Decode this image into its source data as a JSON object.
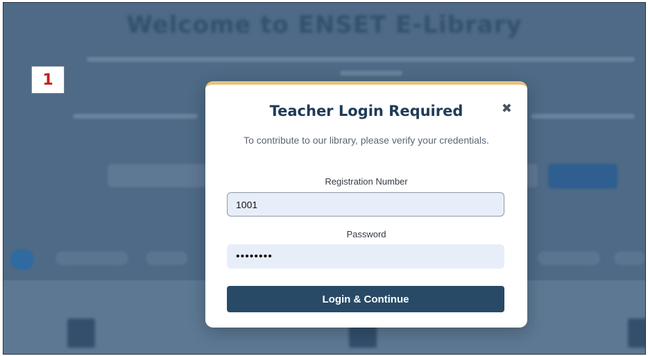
{
  "background": {
    "title": "Welcome to ENSET E-Library"
  },
  "step_badge": "1",
  "modal": {
    "close_icon": "close-x-icon",
    "title": "Teacher Login Required",
    "subtitle": "To contribute to our library, please verify your credentials.",
    "registration_label": "Registration Number",
    "registration_value": "1001",
    "password_label": "Password",
    "password_value": "12345678",
    "submit_label": "Login & Continue"
  },
  "colors": {
    "accent_top_border": "#e8c27a",
    "button": "#284a67",
    "title": "#1f3b58",
    "badge_number": "#c0211f"
  }
}
